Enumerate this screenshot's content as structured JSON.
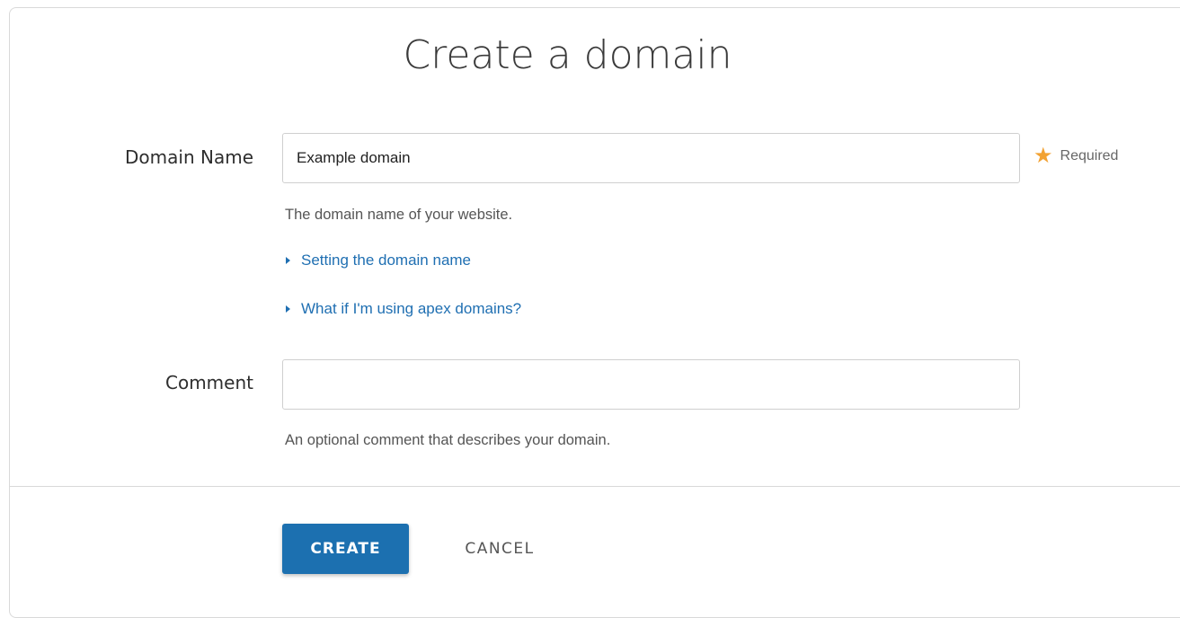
{
  "page": {
    "title": "Create a domain"
  },
  "domain_name": {
    "label": "Domain Name",
    "value": "Example domain",
    "placeholder": "",
    "required_text": "Required",
    "help_text": "The domain name of your website.",
    "links": [
      {
        "label": "Setting the domain name"
      },
      {
        "label": "What if I'm using apex domains?"
      }
    ]
  },
  "comment": {
    "label": "Comment",
    "value": "",
    "placeholder": "",
    "help_text": "An optional comment that describes your domain."
  },
  "actions": {
    "create_label": "CREATE",
    "cancel_label": "CANCEL"
  },
  "colors": {
    "primary": "#1c70b0",
    "link": "#1f6fb2",
    "required_star": "#f2a232"
  },
  "icons": {
    "required": "star-icon",
    "disclosure": "triangle-right-icon"
  }
}
